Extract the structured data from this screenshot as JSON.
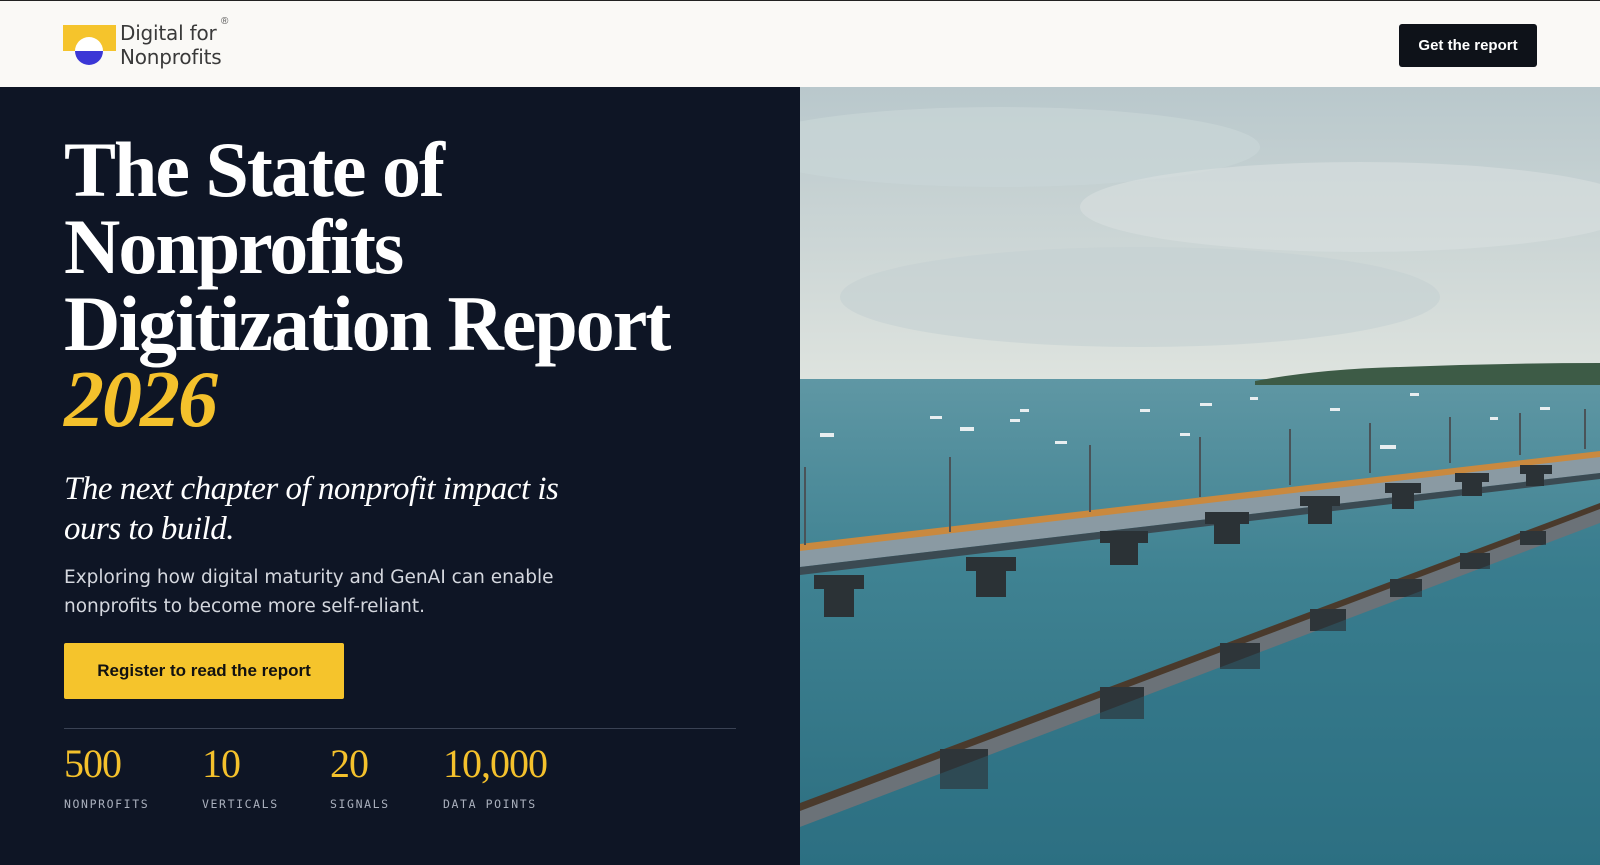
{
  "header": {
    "logo_line1": "Digital for",
    "logo_line2": "Nonprofits",
    "logo_reg": "®",
    "cta_label": "Get the report"
  },
  "hero": {
    "title_line1": "The State of",
    "title_line2": "Nonprofits",
    "title_line3": "Digitization Report",
    "year": "2026",
    "subtitle": "The next chapter of nonprofit impact is ours to build.",
    "description": "Exploring how digital maturity and GenAI can enable nonprofits to become more self-reliant.",
    "cta_label": "Register to read the report"
  },
  "stats": [
    {
      "value": "500",
      "label": "NONPROFITS"
    },
    {
      "value": "10",
      "label": "VERTICALS"
    },
    {
      "value": "20",
      "label": "SIGNALS"
    },
    {
      "value": "10,000",
      "label": "DATA POINTS"
    }
  ],
  "colors": {
    "accent": "#f4c12c",
    "panel": "#0e1525",
    "header_bg": "#faf9f6",
    "logo_blue": "#3b37d6"
  },
  "image": {
    "description_icon": "sea-bridge-photo"
  }
}
